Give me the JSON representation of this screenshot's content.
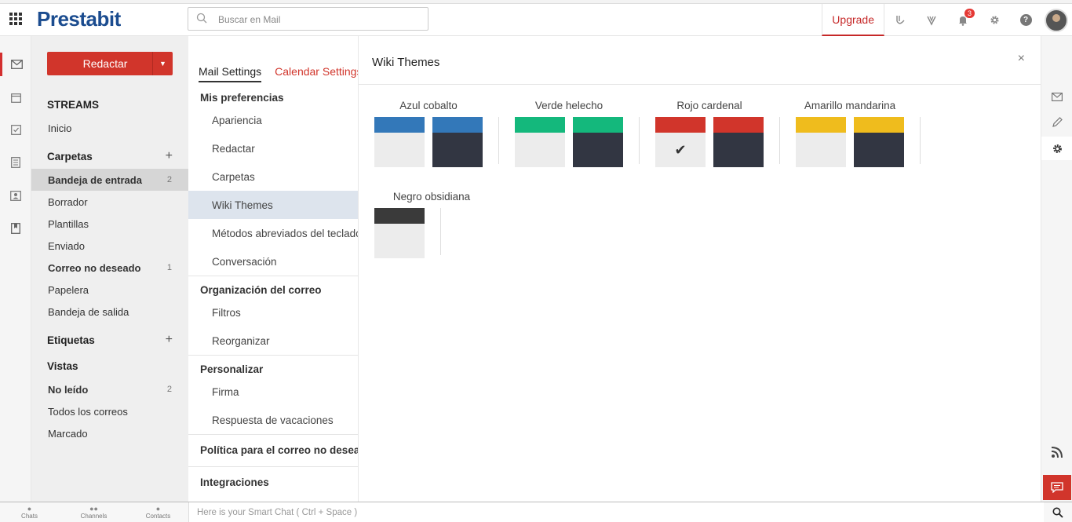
{
  "header": {
    "logo": "Prestabit",
    "search_placeholder": "Buscar en Mail",
    "upgrade_label": "Upgrade",
    "notification_count": "3",
    "help_label": "?"
  },
  "sidebar": {
    "compose_label": "Redactar",
    "streams_label": "STREAMS",
    "inicio_label": "Inicio",
    "folders_label": "Carpetas",
    "folders": [
      {
        "label": "Bandeja de entrada",
        "count": "2"
      },
      {
        "label": "Borrador",
        "count": ""
      },
      {
        "label": "Plantillas",
        "count": ""
      },
      {
        "label": "Enviado",
        "count": ""
      },
      {
        "label": "Correo no deseado",
        "count": "1"
      },
      {
        "label": "Papelera",
        "count": ""
      },
      {
        "label": "Bandeja de salida",
        "count": ""
      }
    ],
    "tags_label": "Etiquetas",
    "views_label": "Vistas",
    "views": [
      {
        "label": "No leído",
        "count": "2"
      },
      {
        "label": "Todos los correos",
        "count": ""
      },
      {
        "label": "Marcado",
        "count": ""
      }
    ]
  },
  "settings": {
    "tabs": [
      "Mail Settings",
      "Calendar Settings"
    ],
    "sections": [
      {
        "title": "Mis preferencias",
        "items": [
          "Apariencia",
          "Redactar",
          "Carpetas",
          "Wiki Themes",
          "Métodos abreviados del teclado",
          "Conversación"
        ]
      },
      {
        "title": "Organización del correo",
        "items": [
          "Filtros",
          "Reorganizar"
        ]
      },
      {
        "title": "Personalizar",
        "items": [
          "Firma",
          "Respuesta de vacaciones"
        ]
      },
      {
        "title": "Política para el correo no deseado",
        "items": []
      },
      {
        "title": "Integraciones",
        "items": []
      }
    ],
    "selected_item": "Wiki Themes"
  },
  "panel": {
    "title": "Wiki Themes",
    "close_label": "×",
    "themes": [
      {
        "name": "Azul cobalto",
        "color": "#3378b9",
        "selected": false
      },
      {
        "name": "Verde helecho",
        "color": "#14b87c",
        "selected": false
      },
      {
        "name": "Rojo cardenal",
        "color": "#d1352b",
        "selected": true
      },
      {
        "name": "Amarillo mandarina",
        "color": "#efbc1d",
        "selected": false
      },
      {
        "name": "Negro obsidiana",
        "color": "#3a3a3a",
        "selected": false
      }
    ],
    "light_body_color": "#ececec",
    "dark_body_color": "#323642",
    "check_mark": "✔"
  },
  "bottom": {
    "tabs": [
      "Chats",
      "Channels",
      "Contacts"
    ],
    "chat_placeholder": "Here is your Smart Chat ( Ctrl + Space )"
  }
}
